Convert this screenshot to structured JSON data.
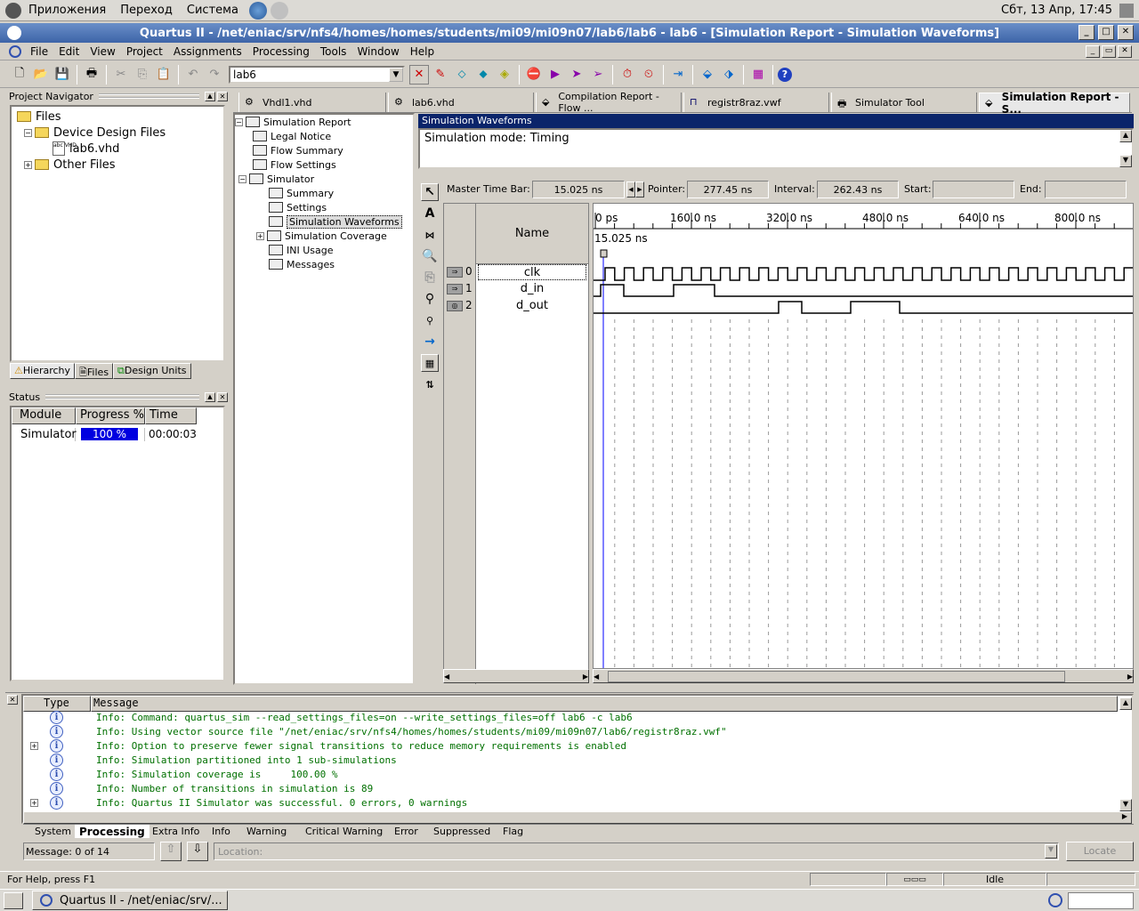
{
  "gnome_panel": {
    "menus": [
      "Приложения",
      "Переход",
      "Система"
    ],
    "clock": "Сбт, 13 Апр, 17:45"
  },
  "window": {
    "title": "Quartus II - /net/eniac/srv/nfs4/homes/homes/students/mi09/mi09n07/lab6/lab6 - lab6 - [Simulation Report - Simulation Waveforms]"
  },
  "menu": [
    "File",
    "Edit",
    "View",
    "Project",
    "Assignments",
    "Processing",
    "Tools",
    "Window",
    "Help"
  ],
  "toolbar": {
    "project_combo": "lab6"
  },
  "project_navigator": {
    "title": "Project Navigator",
    "tree": [
      {
        "label": "Files",
        "level": 0
      },
      {
        "label": "Device Design Files",
        "level": 1
      },
      {
        "label": "lab6.vhd",
        "level": 2
      },
      {
        "label": "Other Files",
        "level": 1
      }
    ],
    "tabs": [
      "Hierarchy",
      "Files",
      "Design Units"
    ]
  },
  "status_panel": {
    "title": "Status",
    "headers": [
      "Module",
      "Progress %",
      "Time"
    ],
    "module": "Simulator",
    "progress": "100 %",
    "time": "00:00:03"
  },
  "doc_tabs": [
    "Vhdl1.vhd",
    "lab6.vhd",
    "Compilation Report - Flow ...",
    "registr8raz.vwf",
    "Simulator Tool",
    "Simulation Report - S..."
  ],
  "report_tree": [
    "Simulation Report",
    "Legal Notice",
    "Flow Summary",
    "Flow Settings",
    "Simulator",
    "Summary",
    "Settings",
    "Simulation Waveforms",
    "Simulation Coverage",
    "INI Usage",
    "Messages"
  ],
  "waveform": {
    "header": "Simulation Waveforms",
    "mode": "Simulation mode: Timing",
    "master_label": "Master Time Bar:",
    "master_value": "15.025 ns",
    "pointer_label": "Pointer:",
    "pointer_value": "277.45 ns",
    "interval_label": "Interval:",
    "interval_value": "262.43 ns",
    "start_label": "Start:",
    "end_label": "End:",
    "name_header": "Name",
    "time_ticks": [
      "0 ps",
      "160.0 ns",
      "320.0 ns",
      "480.0 ns",
      "640.0 ns",
      "800.0 ns"
    ],
    "cursor_label": "15.025 ns",
    "signals": [
      {
        "index": "0",
        "name": "clk"
      },
      {
        "index": "1",
        "name": "d_in"
      },
      {
        "index": "2",
        "name": "d_out"
      }
    ]
  },
  "messages": {
    "col_type": "Type",
    "col_message": "Message",
    "lines": [
      "Info: Command: quartus_sim --read_settings_files=on --write_settings_files=off lab6 -c lab6",
      "Info: Using vector source file \"/net/eniac/srv/nfs4/homes/homes/students/mi09/mi09n07/lab6/registr8raz.vwf\"",
      "Info: Option to preserve fewer signal transitions to reduce memory requirements is enabled",
      "Info: Simulation partitioned into 1 sub-simulations",
      "Info: Simulation coverage is     100.00 %",
      "Info: Number of transitions in simulation is 89",
      "Info: Quartus II Simulator was successful. 0 errors, 0 warnings"
    ],
    "tabs": [
      "System",
      "Processing",
      "Extra Info",
      "Info",
      "Warning",
      "Critical Warning",
      "Error",
      "Suppressed",
      "Flag"
    ],
    "count": "Message: 0 of 14",
    "location_placeholder": "Location:",
    "locate": "Locate"
  },
  "statusbar": {
    "help": "For Help, press F1",
    "state": "Idle"
  },
  "taskbar": {
    "task": "Quartus II - /net/eniac/srv/..."
  }
}
